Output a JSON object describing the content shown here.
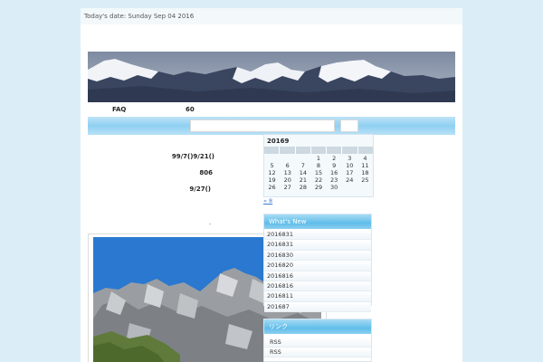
{
  "header": {
    "date_text": "Today's date: Sunday Sep 04 2016"
  },
  "nav": {
    "items": [
      {
        "label": "FAQ"
      },
      {
        "label": "60"
      }
    ]
  },
  "search": {
    "value": "",
    "button_label": ""
  },
  "main": {
    "lines": [
      "99/7()9/21()",
      "806",
      "9/27()",
      "."
    ]
  },
  "calendar": {
    "title": "20169",
    "weekday_headers": [
      "",
      "",
      "",
      "",
      "",
      "",
      ""
    ],
    "cells": [
      "",
      "",
      "",
      "1",
      "2",
      "3",
      "4",
      "5",
      "6",
      "7",
      "8",
      "9",
      "10",
      "11",
      "12",
      "13",
      "14",
      "15",
      "16",
      "17",
      "18",
      "19",
      "20",
      "21",
      "22",
      "23",
      "24",
      "25",
      "26",
      "27",
      "28",
      "29",
      "30",
      "",
      ""
    ],
    "prev_link": "« 8"
  },
  "whats_new": {
    "title": "What's New",
    "items": [
      "2016831",
      "2016831",
      "2016830",
      "2016820",
      "2016816",
      "2016816",
      "2016811",
      "201687"
    ]
  },
  "links_box": {
    "title": "リンク",
    "items": [
      "RSS",
      "RSS"
    ]
  },
  "colors": {
    "page_bg": "#dbeef8",
    "accent": "#5fbde9",
    "sky": "#2a78d0"
  }
}
